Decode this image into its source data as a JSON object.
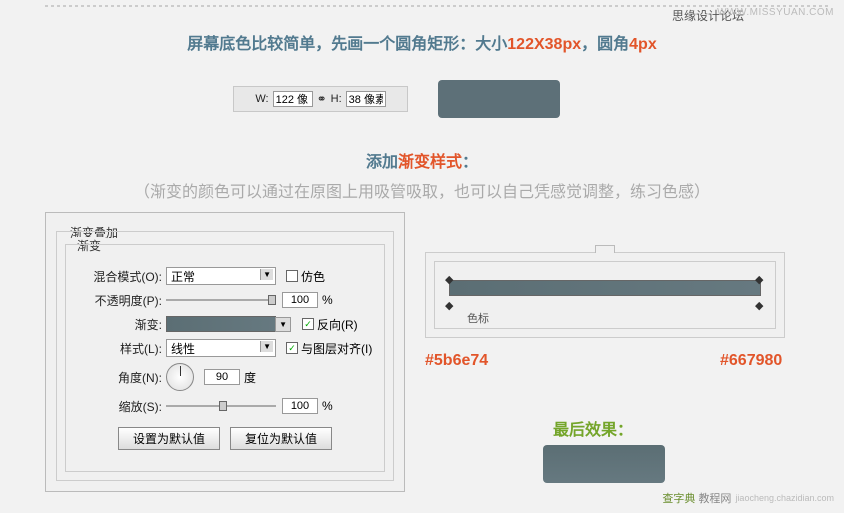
{
  "header": {
    "forum_label": "思缘设计论坛",
    "missyuan_url": "WWW.MISSYUAN.COM"
  },
  "instruction1": {
    "part1": "屏幕底色比较简单，先画一个圆角矩形：大小",
    "size": "122X38px",
    "part2": "，圆角",
    "radius": "4px"
  },
  "wh_panel": {
    "w_label": "W:",
    "w_value": "122 像",
    "h_label": "H:",
    "h_value": "38 像素"
  },
  "instruction2": {
    "part1": "添加",
    "highlight": "渐变样式",
    "part2": "："
  },
  "instruction3": "（渐变的颜色可以通过在原图上用吸管吸取，也可以自己凭感觉调整，练习色感）",
  "ps": {
    "group_title": "渐变叠加",
    "subgroup_title": "渐变",
    "rows": {
      "blend_label": "混合模式(O):",
      "blend_value": "正常",
      "dither_label": "仿色",
      "opacity_label": "不透明度(P):",
      "opacity_value": "100",
      "opacity_unit": "%",
      "gradient_label": "渐变:",
      "reverse_label": "反向(R)",
      "style_label": "样式(L):",
      "style_value": "线性",
      "align_label": "与图层对齐(I)",
      "angle_label": "角度(N):",
      "angle_value": "90",
      "angle_unit": "度",
      "scale_label": "缩放(S):",
      "scale_value": "100",
      "scale_unit": "%"
    },
    "buttons": {
      "set_default": "设置为默认值",
      "reset_default": "复位为默认值"
    }
  },
  "gradient_editor": {
    "se_label": "色标"
  },
  "colors": {
    "hex1": "#5b6e74",
    "hex2": "#667980"
  },
  "final": {
    "label": "最后效果："
  },
  "footer": {
    "site_name": "查字典",
    "site_sub": "教程网",
    "site_url": "jiaocheng.chazidian.com"
  }
}
